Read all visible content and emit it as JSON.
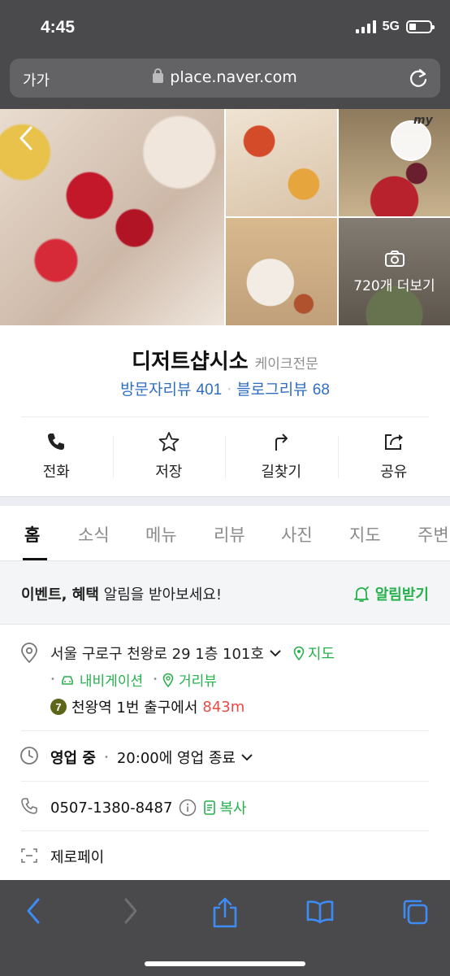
{
  "status": {
    "time": "4:45",
    "network": "5G"
  },
  "browser": {
    "text_size": "가가",
    "url": "place.naver.com"
  },
  "photos": {
    "more_label": "720개 더보기",
    "my_badge": "my"
  },
  "place": {
    "name": "디저트샵시소",
    "category": "케이크전문",
    "visitor_review_label": "방문자리뷰",
    "visitor_review_count": "401",
    "blog_review_label": "블로그리뷰",
    "blog_review_count": "68"
  },
  "actions": [
    {
      "label": "전화",
      "icon": "phone-icon"
    },
    {
      "label": "저장",
      "icon": "star-icon"
    },
    {
      "label": "길찾기",
      "icon": "directions-icon"
    },
    {
      "label": "공유",
      "icon": "share-icon"
    }
  ],
  "tabs": [
    {
      "label": "홈",
      "active": true
    },
    {
      "label": "소식"
    },
    {
      "label": "메뉴"
    },
    {
      "label": "리뷰"
    },
    {
      "label": "사진"
    },
    {
      "label": "지도"
    },
    {
      "label": "주변"
    }
  ],
  "event": {
    "bold_text": "이벤트, 혜택",
    "text": " 알림을 받아보세요!",
    "button": "알림받기"
  },
  "details": {
    "address": "서울 구로구 천왕로 29 1층 101호",
    "map_link": "지도",
    "navigation_link": "내비게이션",
    "street_view_link": "거리뷰",
    "subway_line": "7",
    "subway_text": "천왕역 1번 출구에서",
    "subway_distance": "843m",
    "hours_status": "영업 중",
    "hours_text": "20:00에 영업 종료",
    "phone": "0507-1380-8487",
    "copy_label": "복사",
    "payment": "제로페이"
  },
  "colors": {
    "naver_green": "#27b14c",
    "link_blue": "#2f6ec0",
    "distance_red": "#e94b46",
    "ios_blue": "#3d8bf5"
  }
}
